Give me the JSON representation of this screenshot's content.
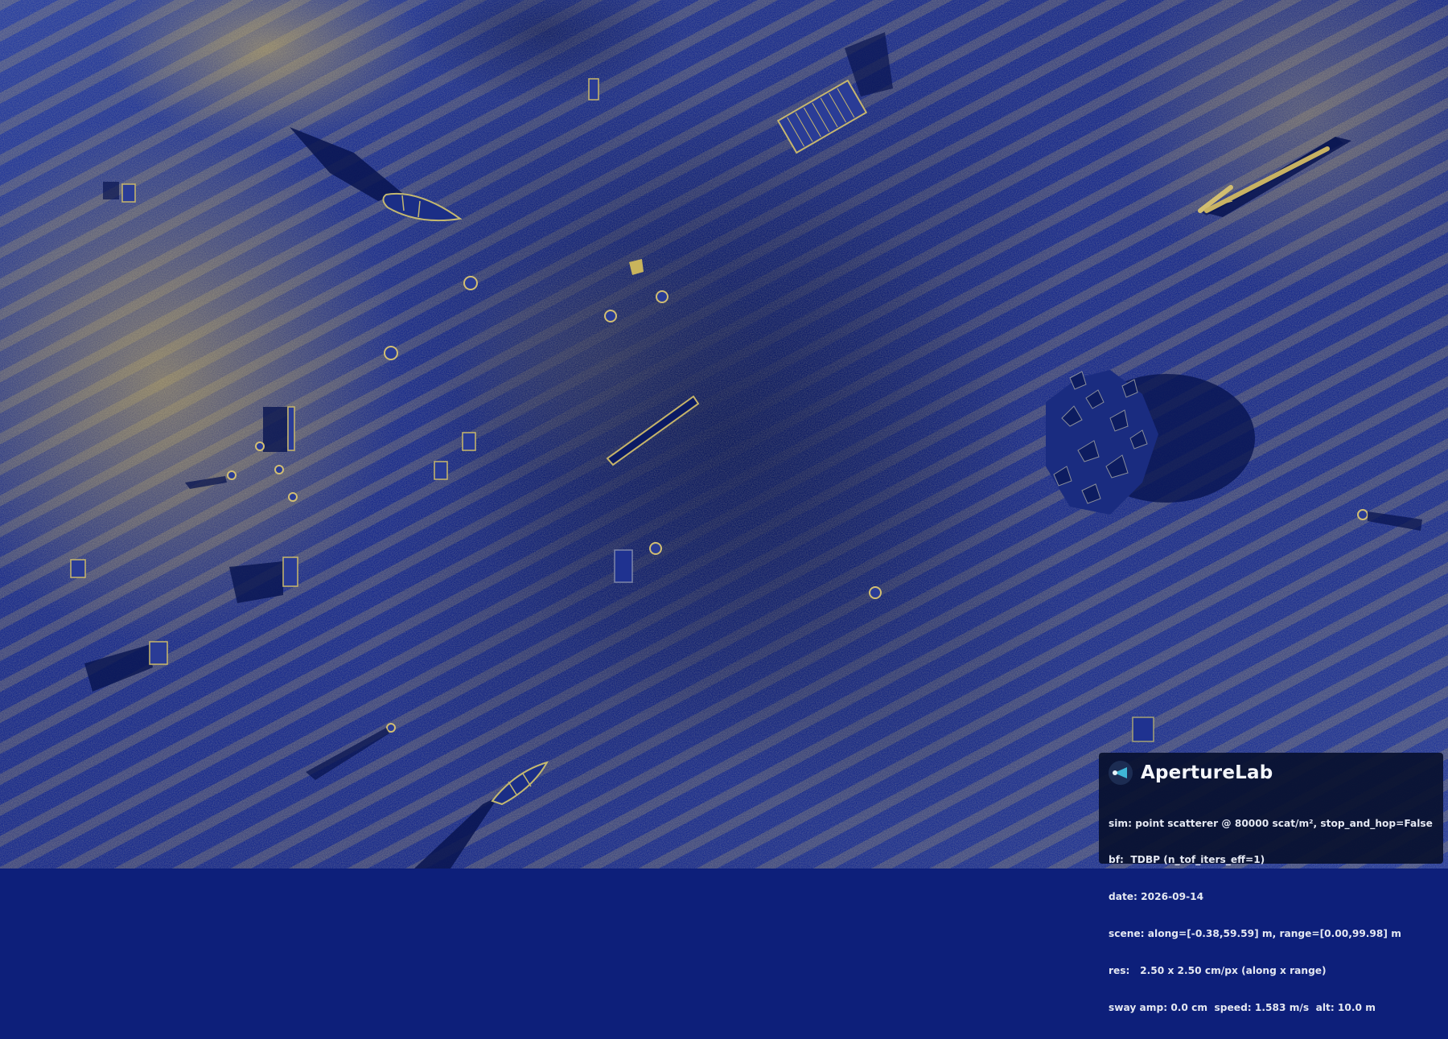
{
  "brand": {
    "name": "ApertureLab",
    "icon": "sonar-beam-icon"
  },
  "info_lines": {
    "sim": "sim: point scatterer @ 80000 scat/m², stop_and_hop=False",
    "bf": "bf:  TDBP (n_tof_iters_eff=1)",
    "date": "date: 2026-09-14",
    "scene": "scene: along=[-0.38,59.59] m, range=[0.00,99.98] m",
    "res": "res:   2.50 x 2.50 cm/px (along x range)",
    "motion": "sway amp: 0.0 cm  speed: 1.583 m/s  alt: 10.0 m"
  },
  "colors": {
    "seabed_dark": "#0c1d78",
    "seabed_mid": "#2a44a8",
    "return_bright": "#c8b050",
    "shadow": "#07124a",
    "overlay_bg": "#08102e"
  }
}
